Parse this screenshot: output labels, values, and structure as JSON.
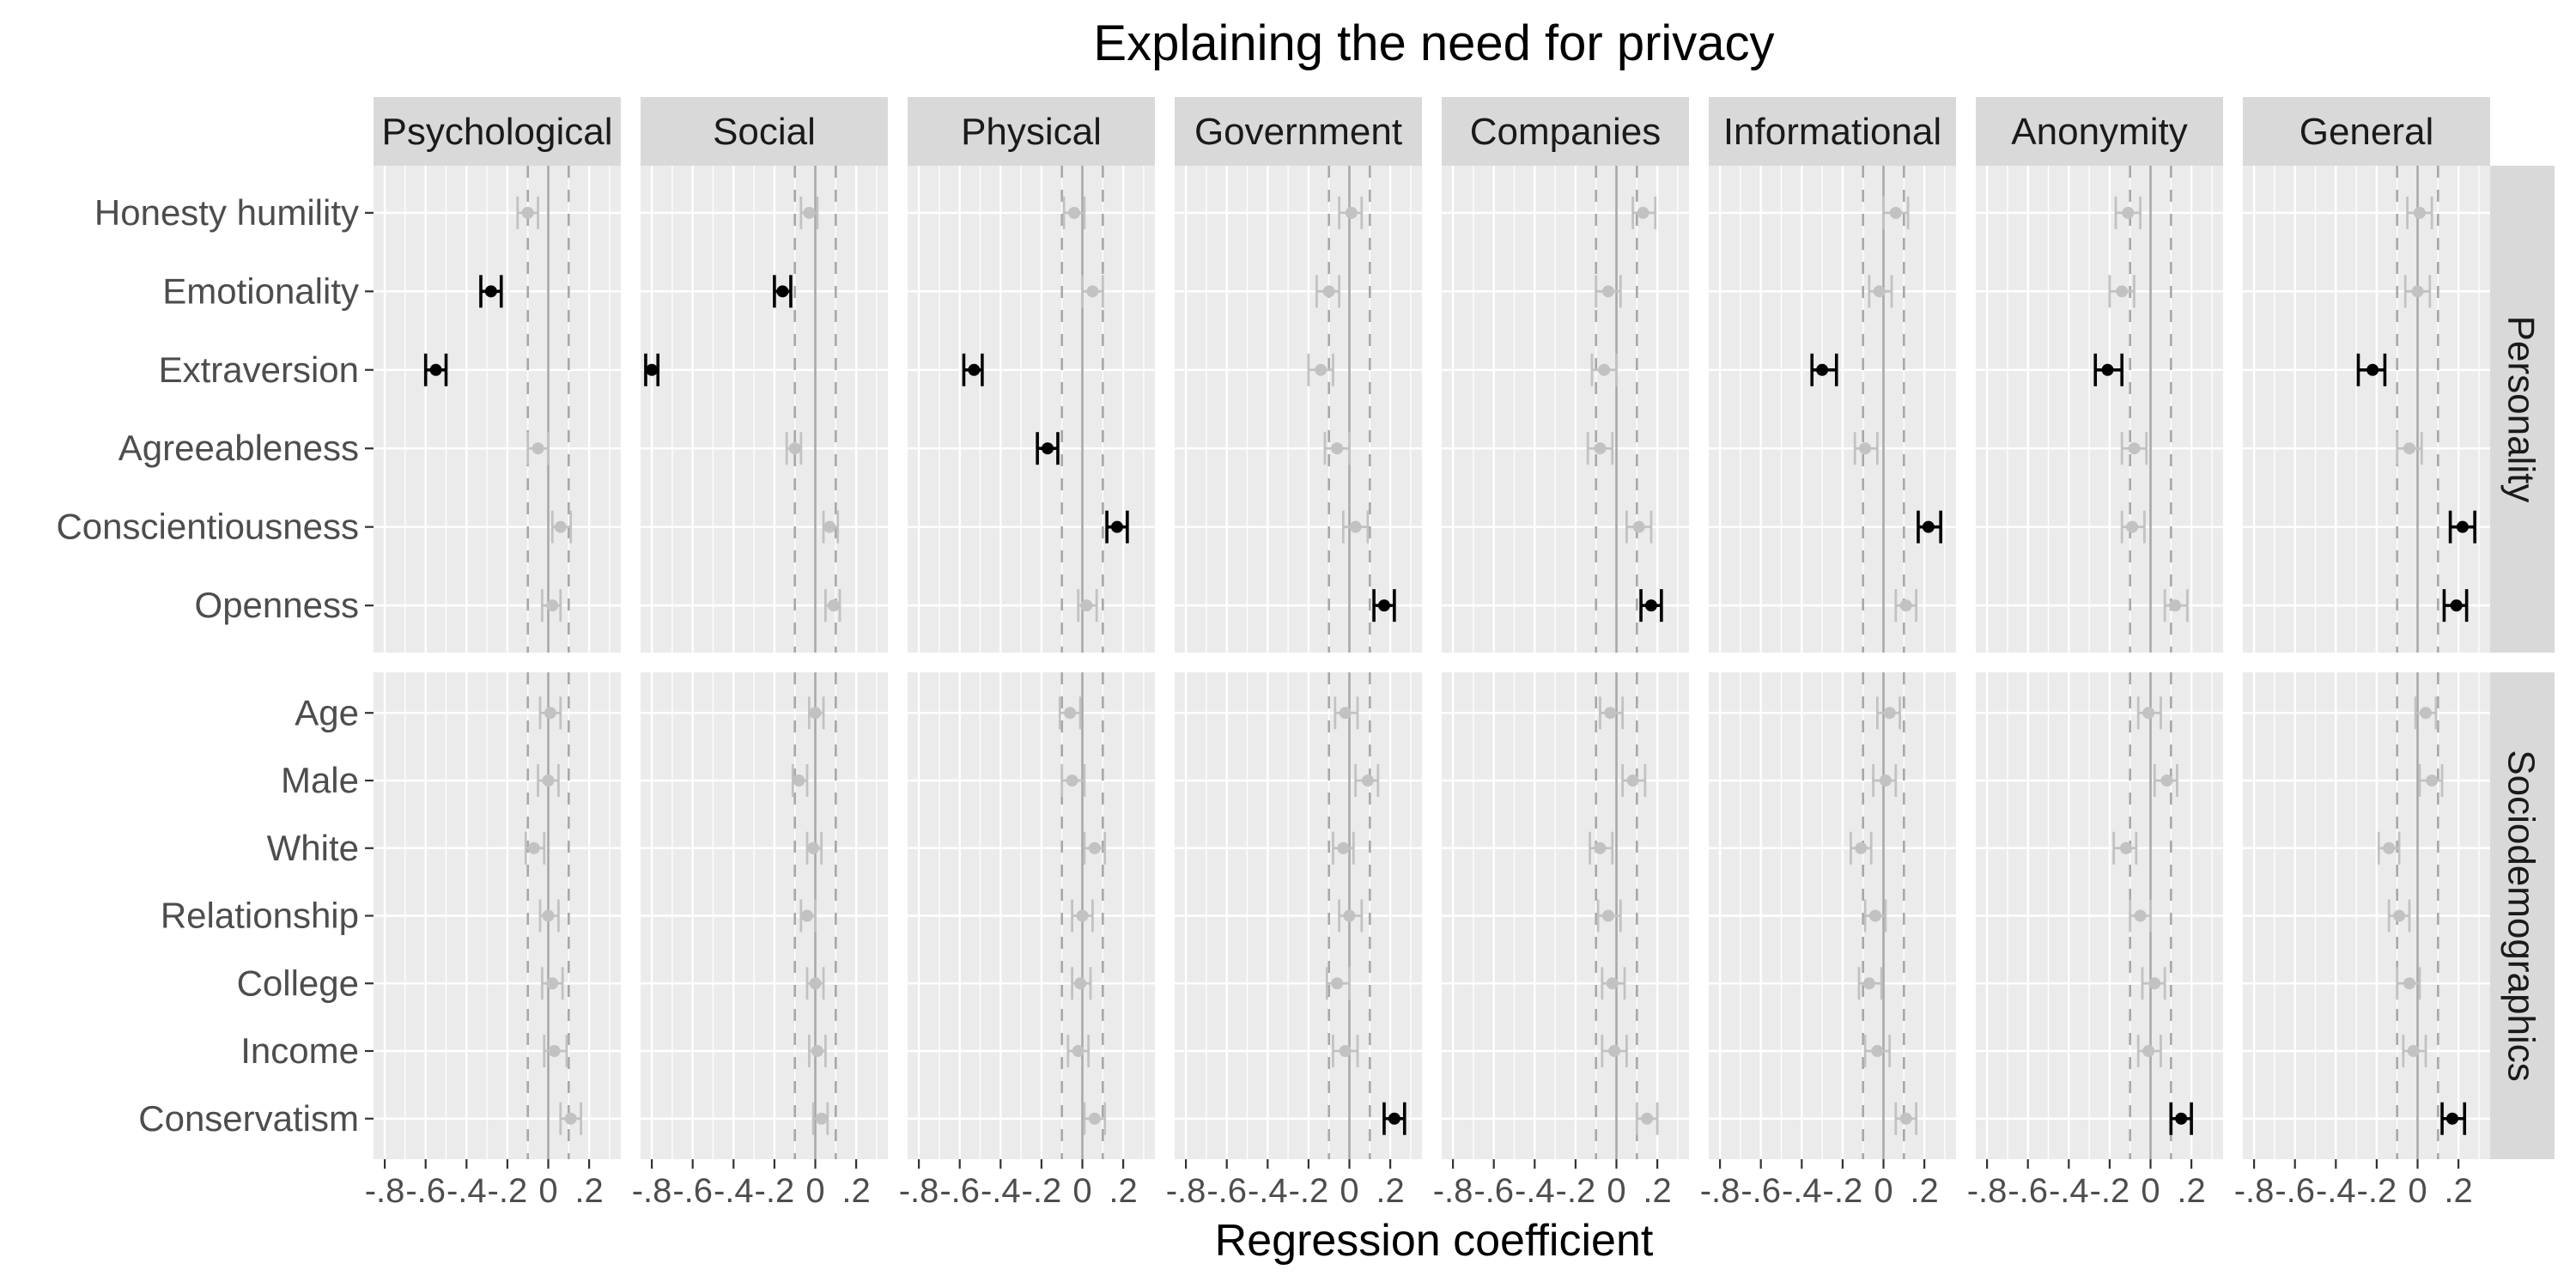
{
  "chart_data": {
    "type": "forest",
    "title": "Explaining the need for privacy",
    "xlabel": "Regression coefficient",
    "ylabel": "",
    "xlim": [
      -0.855,
      0.355
    ],
    "x_ticks": [
      -0.8,
      -0.6,
      -0.4,
      -0.2,
      0,
      0.2
    ],
    "x_tick_labels": [
      "-.8",
      "-.6",
      "-.4",
      "-.2",
      "0",
      ".2"
    ],
    "grid": true,
    "reference_line": 0,
    "equivalence_bounds": [
      -0.1,
      0.1
    ],
    "colors": {
      "significant": "#000000",
      "non_significant": "#c2c2c2",
      "panel_bg": "#ebebeb",
      "strip_bg": "#d9d9d9",
      "grid": "#ffffff",
      "reference": "#a8a8a8",
      "bounds": "#a8a8a8"
    },
    "columns": [
      "Psychological",
      "Social",
      "Physical",
      "Government",
      "Companies",
      "Informational",
      "Anonymity",
      "General"
    ],
    "rows": [
      {
        "group": "Personality",
        "predictors": [
          "Honesty humility",
          "Emotionality",
          "Extraversion",
          "Agreeableness",
          "Conscientiousness",
          "Openness"
        ],
        "estimates": {
          "Psychological": [
            {
              "est": -0.1,
              "lo": -0.15,
              "hi": -0.05,
              "significant": false
            },
            {
              "est": -0.28,
              "lo": -0.33,
              "hi": -0.23,
              "significant": true
            },
            {
              "est": -0.55,
              "lo": -0.6,
              "hi": -0.5,
              "significant": true
            },
            {
              "est": -0.05,
              "lo": -0.1,
              "hi": 0.0,
              "significant": false
            },
            {
              "est": 0.06,
              "lo": 0.02,
              "hi": 0.11,
              "significant": false
            },
            {
              "est": 0.02,
              "lo": -0.03,
              "hi": 0.06,
              "significant": false
            }
          ],
          "Social": [
            {
              "est": -0.03,
              "lo": -0.07,
              "hi": 0.01,
              "significant": false
            },
            {
              "est": -0.16,
              "lo": -0.2,
              "hi": -0.12,
              "significant": true
            },
            {
              "est": -0.8,
              "lo": -0.83,
              "hi": -0.77,
              "significant": true
            },
            {
              "est": -0.1,
              "lo": -0.14,
              "hi": -0.07,
              "significant": false
            },
            {
              "est": 0.07,
              "lo": 0.04,
              "hi": 0.11,
              "significant": false
            },
            {
              "est": 0.09,
              "lo": 0.05,
              "hi": 0.12,
              "significant": false
            }
          ],
          "Physical": [
            {
              "est": -0.04,
              "lo": -0.09,
              "hi": 0.01,
              "significant": false
            },
            {
              "est": 0.05,
              "lo": 0.0,
              "hi": 0.1,
              "significant": false
            },
            {
              "est": -0.53,
              "lo": -0.58,
              "hi": -0.49,
              "significant": true
            },
            {
              "est": -0.17,
              "lo": -0.22,
              "hi": -0.12,
              "significant": true
            },
            {
              "est": 0.17,
              "lo": 0.12,
              "hi": 0.22,
              "significant": true
            },
            {
              "est": 0.02,
              "lo": -0.02,
              "hi": 0.07,
              "significant": false
            }
          ],
          "Government": [
            {
              "est": 0.01,
              "lo": -0.05,
              "hi": 0.06,
              "significant": false
            },
            {
              "est": -0.1,
              "lo": -0.16,
              "hi": -0.05,
              "significant": false
            },
            {
              "est": -0.14,
              "lo": -0.2,
              "hi": -0.08,
              "significant": false
            },
            {
              "est": -0.06,
              "lo": -0.12,
              "hi": 0.0,
              "significant": false
            },
            {
              "est": 0.03,
              "lo": -0.03,
              "hi": 0.09,
              "significant": false
            },
            {
              "est": 0.17,
              "lo": 0.12,
              "hi": 0.22,
              "significant": true
            }
          ],
          "Companies": [
            {
              "est": 0.13,
              "lo": 0.08,
              "hi": 0.19,
              "significant": false
            },
            {
              "est": -0.04,
              "lo": -0.1,
              "hi": 0.02,
              "significant": false
            },
            {
              "est": -0.06,
              "lo": -0.12,
              "hi": 0.0,
              "significant": false
            },
            {
              "est": -0.08,
              "lo": -0.14,
              "hi": -0.02,
              "significant": false
            },
            {
              "est": 0.11,
              "lo": 0.05,
              "hi": 0.17,
              "significant": false
            },
            {
              "est": 0.17,
              "lo": 0.12,
              "hi": 0.22,
              "significant": true
            }
          ],
          "Informational": [
            {
              "est": 0.06,
              "lo": 0.0,
              "hi": 0.12,
              "significant": false
            },
            {
              "est": -0.02,
              "lo": -0.07,
              "hi": 0.04,
              "significant": false
            },
            {
              "est": -0.3,
              "lo": -0.35,
              "hi": -0.23,
              "significant": true
            },
            {
              "est": -0.09,
              "lo": -0.14,
              "hi": -0.03,
              "significant": false
            },
            {
              "est": 0.22,
              "lo": 0.17,
              "hi": 0.28,
              "significant": true
            },
            {
              "est": 0.11,
              "lo": 0.06,
              "hi": 0.16,
              "significant": false
            }
          ],
          "Anonymity": [
            {
              "est": -0.11,
              "lo": -0.17,
              "hi": -0.05,
              "significant": false
            },
            {
              "est": -0.14,
              "lo": -0.2,
              "hi": -0.08,
              "significant": false
            },
            {
              "est": -0.21,
              "lo": -0.27,
              "hi": -0.14,
              "significant": true
            },
            {
              "est": -0.08,
              "lo": -0.14,
              "hi": -0.02,
              "significant": false
            },
            {
              "est": -0.09,
              "lo": -0.14,
              "hi": -0.03,
              "significant": false
            },
            {
              "est": 0.12,
              "lo": 0.07,
              "hi": 0.18,
              "significant": false
            }
          ],
          "General": [
            {
              "est": 0.01,
              "lo": -0.05,
              "hi": 0.07,
              "significant": false
            },
            {
              "est": 0.0,
              "lo": -0.06,
              "hi": 0.06,
              "significant": false
            },
            {
              "est": -0.22,
              "lo": -0.29,
              "hi": -0.16,
              "significant": true
            },
            {
              "est": -0.04,
              "lo": -0.1,
              "hi": 0.02,
              "significant": false
            },
            {
              "est": 0.22,
              "lo": 0.16,
              "hi": 0.28,
              "significant": true
            },
            {
              "est": 0.19,
              "lo": 0.13,
              "hi": 0.24,
              "significant": true
            }
          ]
        }
      },
      {
        "group": "Sociodemographics",
        "predictors": [
          "Age",
          "Male",
          "White",
          "Relationship",
          "College",
          "Income",
          "Conservatism"
        ],
        "estimates": {
          "Psychological": [
            {
              "est": 0.01,
              "lo": -0.04,
              "hi": 0.06,
              "significant": false
            },
            {
              "est": 0.0,
              "lo": -0.05,
              "hi": 0.05,
              "significant": false
            },
            {
              "est": -0.07,
              "lo": -0.11,
              "hi": -0.02,
              "significant": false
            },
            {
              "est": 0.0,
              "lo": -0.04,
              "hi": 0.05,
              "significant": false
            },
            {
              "est": 0.02,
              "lo": -0.03,
              "hi": 0.07,
              "significant": false
            },
            {
              "est": 0.03,
              "lo": -0.02,
              "hi": 0.09,
              "significant": false
            },
            {
              "est": 0.11,
              "lo": 0.06,
              "hi": 0.16,
              "significant": false
            }
          ],
          "Social": [
            {
              "est": 0.0,
              "lo": -0.03,
              "hi": 0.04,
              "significant": false
            },
            {
              "est": -0.08,
              "lo": -0.11,
              "hi": -0.04,
              "significant": false
            },
            {
              "est": -0.01,
              "lo": -0.04,
              "hi": 0.03,
              "significant": false
            },
            {
              "est": -0.04,
              "lo": -0.07,
              "hi": 0.0,
              "significant": false
            },
            {
              "est": 0.0,
              "lo": -0.04,
              "hi": 0.04,
              "significant": false
            },
            {
              "est": 0.01,
              "lo": -0.03,
              "hi": 0.05,
              "significant": false
            },
            {
              "est": 0.03,
              "lo": -0.01,
              "hi": 0.06,
              "significant": false
            }
          ],
          "Physical": [
            {
              "est": -0.06,
              "lo": -0.11,
              "hi": -0.01,
              "significant": false
            },
            {
              "est": -0.05,
              "lo": -0.1,
              "hi": 0.01,
              "significant": false
            },
            {
              "est": 0.06,
              "lo": 0.01,
              "hi": 0.11,
              "significant": false
            },
            {
              "est": 0.0,
              "lo": -0.05,
              "hi": 0.05,
              "significant": false
            },
            {
              "est": -0.01,
              "lo": -0.05,
              "hi": 0.04,
              "significant": false
            },
            {
              "est": -0.02,
              "lo": -0.07,
              "hi": 0.03,
              "significant": false
            },
            {
              "est": 0.06,
              "lo": 0.01,
              "hi": 0.11,
              "significant": false
            }
          ],
          "Government": [
            {
              "est": -0.02,
              "lo": -0.07,
              "hi": 0.04,
              "significant": false
            },
            {
              "est": 0.09,
              "lo": 0.03,
              "hi": 0.14,
              "significant": false
            },
            {
              "est": -0.03,
              "lo": -0.08,
              "hi": 0.02,
              "significant": false
            },
            {
              "est": 0.0,
              "lo": -0.05,
              "hi": 0.06,
              "significant": false
            },
            {
              "est": -0.06,
              "lo": -0.11,
              "hi": 0.0,
              "significant": false
            },
            {
              "est": -0.02,
              "lo": -0.08,
              "hi": 0.04,
              "significant": false
            },
            {
              "est": 0.22,
              "lo": 0.17,
              "hi": 0.27,
              "significant": true
            }
          ],
          "Companies": [
            {
              "est": -0.03,
              "lo": -0.08,
              "hi": 0.03,
              "significant": false
            },
            {
              "est": 0.08,
              "lo": 0.03,
              "hi": 0.14,
              "significant": false
            },
            {
              "est": -0.08,
              "lo": -0.13,
              "hi": -0.02,
              "significant": false
            },
            {
              "est": -0.04,
              "lo": -0.09,
              "hi": 0.02,
              "significant": false
            },
            {
              "est": -0.02,
              "lo": -0.07,
              "hi": 0.04,
              "significant": false
            },
            {
              "est": -0.01,
              "lo": -0.07,
              "hi": 0.05,
              "significant": false
            },
            {
              "est": 0.15,
              "lo": 0.1,
              "hi": 0.2,
              "significant": false
            }
          ],
          "Informational": [
            {
              "est": 0.03,
              "lo": -0.03,
              "hi": 0.08,
              "significant": false
            },
            {
              "est": 0.01,
              "lo": -0.05,
              "hi": 0.06,
              "significant": false
            },
            {
              "est": -0.11,
              "lo": -0.16,
              "hi": -0.06,
              "significant": false
            },
            {
              "est": -0.04,
              "lo": -0.09,
              "hi": 0.01,
              "significant": false
            },
            {
              "est": -0.07,
              "lo": -0.12,
              "hi": -0.01,
              "significant": false
            },
            {
              "est": -0.03,
              "lo": -0.09,
              "hi": 0.03,
              "significant": false
            },
            {
              "est": 0.11,
              "lo": 0.06,
              "hi": 0.16,
              "significant": false
            }
          ],
          "Anonymity": [
            {
              "est": -0.01,
              "lo": -0.06,
              "hi": 0.05,
              "significant": false
            },
            {
              "est": 0.08,
              "lo": 0.02,
              "hi": 0.13,
              "significant": false
            },
            {
              "est": -0.12,
              "lo": -0.18,
              "hi": -0.07,
              "significant": false
            },
            {
              "est": -0.05,
              "lo": -0.1,
              "hi": 0.0,
              "significant": false
            },
            {
              "est": 0.02,
              "lo": -0.04,
              "hi": 0.07,
              "significant": false
            },
            {
              "est": -0.01,
              "lo": -0.06,
              "hi": 0.05,
              "significant": false
            },
            {
              "est": 0.15,
              "lo": 0.1,
              "hi": 0.2,
              "significant": true
            }
          ],
          "General": [
            {
              "est": 0.04,
              "lo": -0.01,
              "hi": 0.09,
              "significant": false
            },
            {
              "est": 0.07,
              "lo": 0.01,
              "hi": 0.12,
              "significant": false
            },
            {
              "est": -0.14,
              "lo": -0.19,
              "hi": -0.09,
              "significant": false
            },
            {
              "est": -0.09,
              "lo": -0.14,
              "hi": -0.04,
              "significant": false
            },
            {
              "est": -0.04,
              "lo": -0.1,
              "hi": 0.01,
              "significant": false
            },
            {
              "est": -0.02,
              "lo": -0.07,
              "hi": 0.04,
              "significant": false
            },
            {
              "est": 0.17,
              "lo": 0.12,
              "hi": 0.23,
              "significant": true
            }
          ]
        }
      }
    ]
  }
}
